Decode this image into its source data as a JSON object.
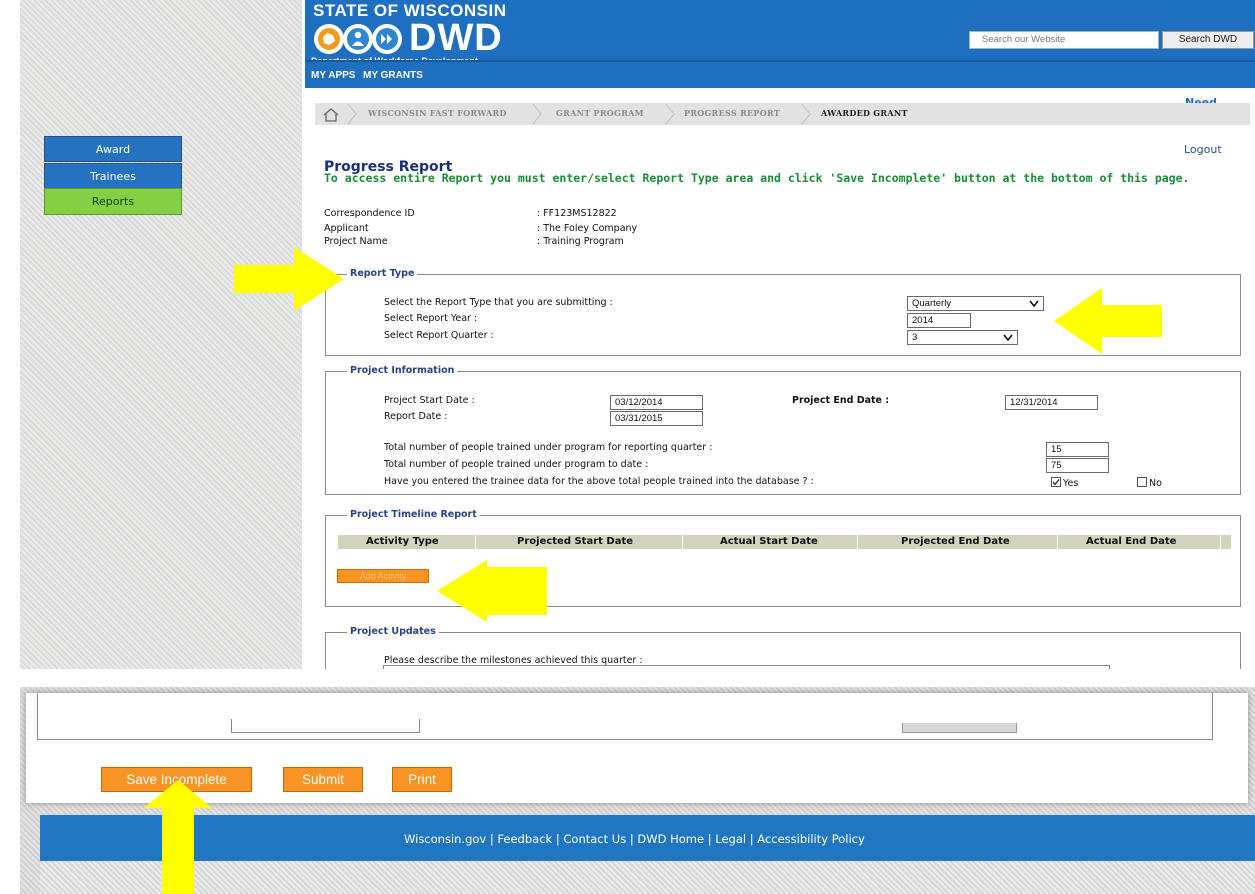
{
  "header": {
    "state_title": "STATE OF WISCONSIN",
    "logo_text": "DWD",
    "department": "Department of Workforce Development",
    "search_placeholder": "Search our Website",
    "search_button": "Search DWD",
    "brand_color": "#1f6fc0"
  },
  "nav": {
    "my_apps": "MY APPS",
    "my_grants": "MY GRANTS"
  },
  "need_help": "Need Help?",
  "breadcrumb": [
    "WISCONSIN FAST FORWARD",
    "GRANT PROGRAM",
    "PROGRESS REPORT",
    "AWARDED GRANT"
  ],
  "sidebar": {
    "items": [
      {
        "label": "Award"
      },
      {
        "label": "Trainees"
      },
      {
        "label": "Reports"
      }
    ],
    "active_color": "#84cf43"
  },
  "logout": "Logout",
  "page": {
    "title": "Progress Report",
    "instructions": "To access entire Report you must enter/select Report Type area and click 'Save Incomplete' button at the bottom of this page."
  },
  "info": {
    "correspondence_label": "Correspondence ID",
    "correspondence_value": ": FF123MS12822",
    "applicant_label": "Applicant",
    "applicant_value": ": The Foley Company",
    "project_label": "Project Name",
    "project_value": ": Training Program"
  },
  "report_type": {
    "legend": "Report Type",
    "type_label": "Select the Report Type that you are submitting :",
    "type_value": "Quarterly",
    "year_label": "Select Report Year :",
    "year_value": "2014",
    "quarter_label": "Select Report Quarter :",
    "quarter_value": "3"
  },
  "project_info": {
    "legend": "Project Information",
    "start_label": "Project Start Date :",
    "start_value": "03/12/2014",
    "end_label": "Project End Date :",
    "end_value": "12/31/2014",
    "report_date_label": "Report Date :",
    "report_date_value": "03/31/2015",
    "trained_quarter_label": "Total number of people trained under program for reporting quarter :",
    "trained_quarter_value": "15",
    "trained_to_date_label": "Total number of people trained under program to date :",
    "trained_to_date_value": "75",
    "entered_label": "Have you entered the trainee data for the above total people trained into the database ? :",
    "yes_label": "Yes",
    "no_label": "No"
  },
  "timeline": {
    "legend": "Project Timeline Report",
    "columns": [
      "Activity Type",
      "Projected Start Date",
      "Actual Start Date",
      "Projected End Date",
      "Actual End Date"
    ],
    "add_button": "Add Activity"
  },
  "updates": {
    "legend": "Project Updates",
    "milestones_label": "Please describe the milestones achieved this quarter :"
  },
  "actions": {
    "save_incomplete": "Save Incomplete",
    "submit": "Submit",
    "print": "Print",
    "button_color": "#f79424"
  },
  "footer": {
    "links": [
      "Wisconsin.gov",
      "Feedback",
      "Contact Us",
      "DWD Home",
      "Legal",
      "Accessibility Policy"
    ]
  },
  "annotation": {
    "arrow_color": "#ffff00"
  }
}
